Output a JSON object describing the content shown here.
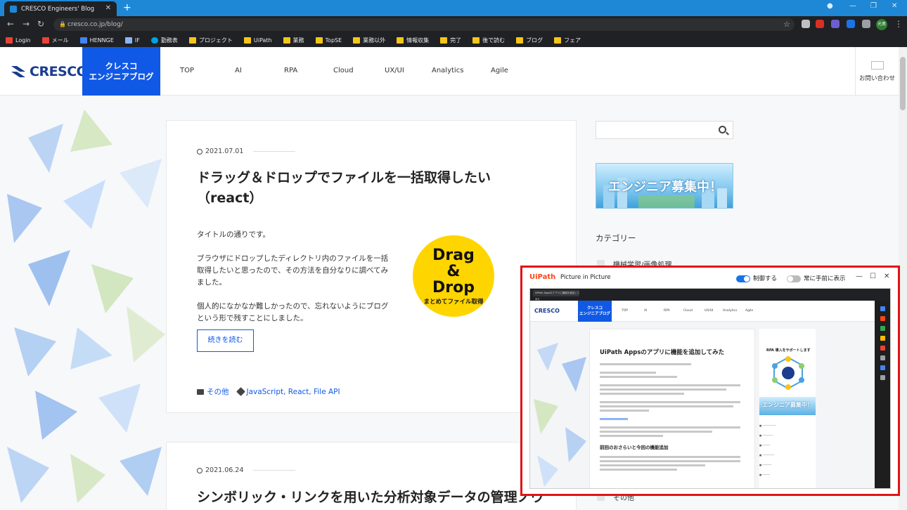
{
  "browser": {
    "tab_title": "CRESCO Engineers' Blog",
    "url": "cresco.co.jp/blog/",
    "profile": "光男",
    "bookmarks": [
      "Login",
      "メール",
      "HENNGE",
      "IF",
      "勤務表",
      "プロジェクト",
      "UiPath",
      "業務",
      "TopSE",
      "業務以外",
      "情報収集",
      "完了",
      "後で読む",
      "ブログ",
      "フェア"
    ]
  },
  "site": {
    "logo": "CRESCO",
    "blog_tag_line1": "クレスコ",
    "blog_tag_line2": "エンジニアブログ",
    "nav": [
      "TOP",
      "AI",
      "RPA",
      "Cloud",
      "UX/UI",
      "Analytics",
      "Agile"
    ],
    "contact": "お問い合わせ"
  },
  "post1": {
    "date": "2021.07.01",
    "title_line1": "ドラッグ＆ドロップでファイルを一括取得したい",
    "title_line2": "（react）",
    "p1": "タイトルの通りです。",
    "p2_l1": "ブラウザにドロップしたディレクトリ内のファイルを一括",
    "p2_l2": "取得したいと思ったので、その方法を自分なりに調べてみ",
    "p2_l3": "ました。",
    "p3_l1": "個人的になかなか難しかったので、忘れないようにブログ",
    "p3_l2": "という形で残すことにしました。",
    "image_l1": "Drag",
    "image_l2": "&",
    "image_l3": "Drop",
    "image_sub": "まとめてファイル取得",
    "read_more": "続きを読む",
    "category": "その他",
    "tags": "JavaScript, React, File API"
  },
  "post2": {
    "date": "2021.06.24",
    "title": "シンボリック・リンクを用いた分析対象データの管理ノウ"
  },
  "sidebar": {
    "banner": "エンジニア募集中！",
    "categories_heading": "カテゴリー",
    "cat1": "機械学習/画像処理",
    "cat_last": "その他"
  },
  "pip": {
    "app": "UiPath",
    "title": "Picture in Picture",
    "control_label": "制御する",
    "ontop_label": "常に手前に表示",
    "inner_tab": "UiPath Appsのアプリに機能を追加してみた",
    "inner_title": "UiPath Appsのアプリに機能を追加してみた",
    "inner_heading": "前回のおさらいと今回の機能追加",
    "inner_side_title": "RPA 導入をサポートします",
    "inner_banner": "エンジニア募集中！",
    "inner_nav": [
      "TOP",
      "AI",
      "RPA",
      "Cloud",
      "UX/UI",
      "Analytics",
      "Agile"
    ]
  },
  "colors": {
    "accent": "#1059e6",
    "pip_border": "#e01414",
    "chrome_title": "#1e88d6"
  }
}
